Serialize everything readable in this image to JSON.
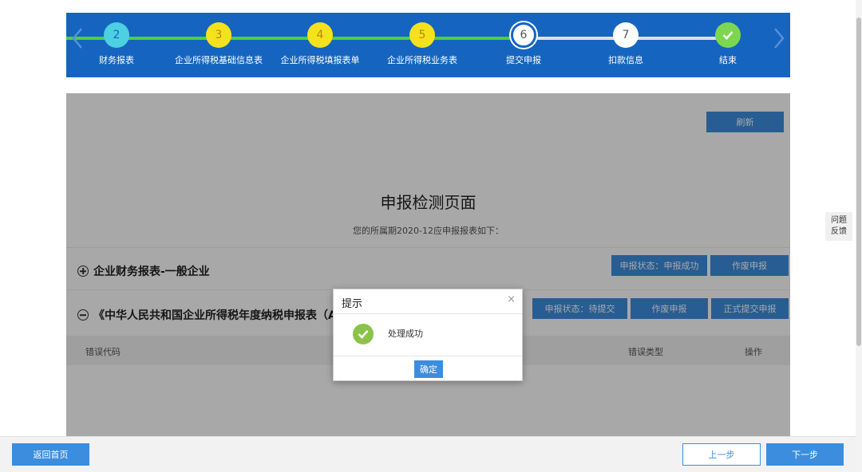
{
  "stepper": {
    "steps": [
      {
        "number": "2",
        "label": "财务报表"
      },
      {
        "number": "3",
        "label": "企业所得税基础信息表"
      },
      {
        "number": "4",
        "label": "企业所得税填报表单"
      },
      {
        "number": "5",
        "label": "企业所得税业务表"
      },
      {
        "number": "6",
        "label": "提交申报"
      },
      {
        "number": "7",
        "label": "扣款信息"
      },
      {
        "number": "",
        "label": "结束"
      }
    ],
    "current_step": "6",
    "colors": {
      "background": "#1565c0",
      "done_line": "#4cd137",
      "pending_line": "#e0e0e0"
    }
  },
  "panel": {
    "refresh_label": "刷新",
    "title": "申报检测页面",
    "subtitle": "您的所属期2020-12应申报报表如下：",
    "rows": [
      {
        "title": "企业财务报表-一般企业",
        "status": "申报状态：申报成功",
        "void_label": "作废申报"
      },
      {
        "title": "《中华人民共和国企业所得税年度纳税申报表（A类",
        "status": "申报状态：待提交",
        "void_label": "作废申报",
        "submit_label": "正式提交申报"
      }
    ],
    "table_headers": {
      "error_code": "错误代码",
      "error_type": "错误类型",
      "action": "操作"
    }
  },
  "modal": {
    "title": "提示",
    "close": "×",
    "message": "处理成功",
    "ok_label": "确定"
  },
  "feedback": {
    "line1": "问题",
    "line2": "反馈"
  },
  "bottom": {
    "home_label": "返回首页",
    "prev_label": "上一步",
    "next_label": "下一步"
  }
}
